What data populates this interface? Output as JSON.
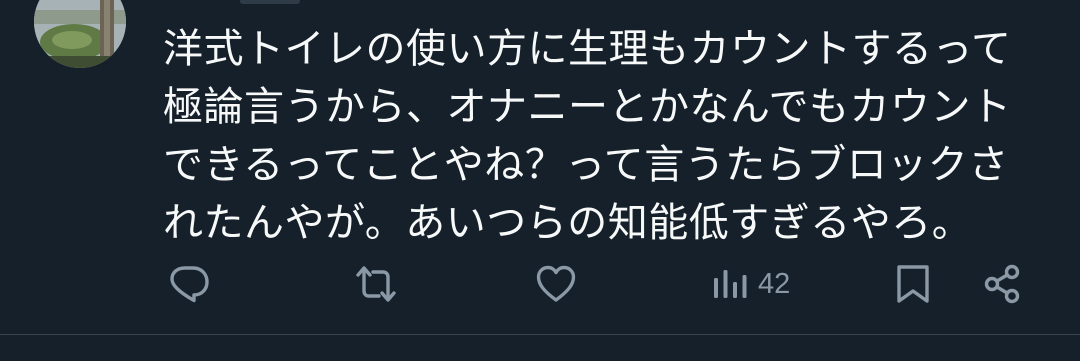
{
  "tweet": {
    "text": "洋式トイレの使い方に生理もカウントするって\n極論言うから、オナニーとかなんでもカウント\nできるってことやね？って言うたらブロックさ\nれたんやが。あいつらの知能低すぎるやろ。"
  },
  "actions": {
    "views_count": "42"
  },
  "icons": {
    "reply": "reply-icon",
    "retweet": "retweet-icon",
    "like": "heart-icon",
    "views": "views-icon",
    "bookmark": "bookmark-icon",
    "share": "share-icon"
  },
  "colors": {
    "background": "#15202b",
    "text": "#f7f9f9",
    "icon": "#8b98a5",
    "divider": "#38444d"
  }
}
